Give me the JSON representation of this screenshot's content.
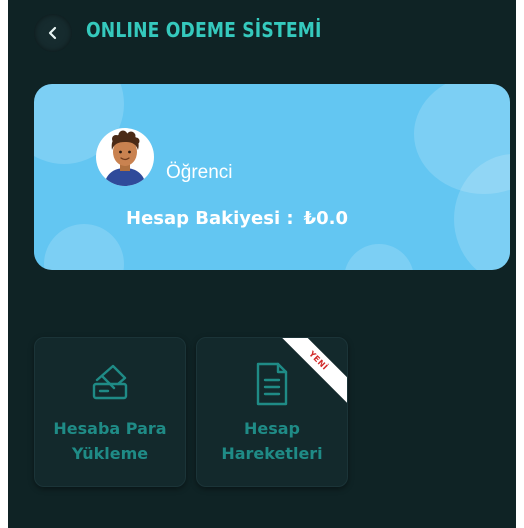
{
  "header": {
    "title": "ONLINE ODEME SİSTEMİ",
    "back_icon": "chevron-left-icon"
  },
  "account_card": {
    "avatar_icon": "student-avatar-icon",
    "role": "Öğrenci",
    "balance_label": "Hesap Bakiyesi :",
    "balance_value": "₺0.0"
  },
  "actions": [
    {
      "label_line1": "Hesaba Para",
      "label_line2": "Yükleme",
      "icon": "card-payment-icon"
    },
    {
      "label_line1": "Hesap",
      "label_line2": "Hareketleri",
      "icon": "document-list-icon",
      "badge": "YENİ"
    }
  ],
  "colors": {
    "background": "#0f2325",
    "accent": "#35c9bd",
    "card": "#63c6f2",
    "tile": "#13292c",
    "tile_text": "#1f8b86",
    "badge_text": "#d22b2b"
  }
}
